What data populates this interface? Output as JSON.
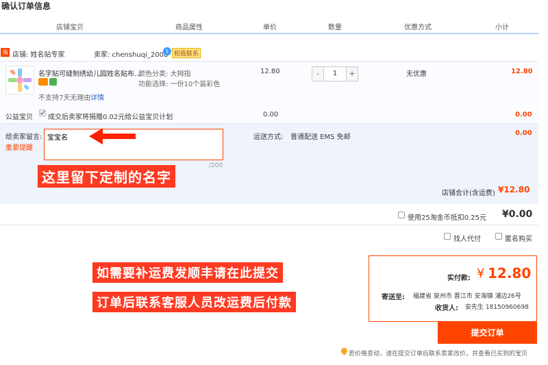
{
  "page_title": "确认订单信息",
  "columns": [
    "店铺宝贝",
    "商品属性",
    "单价",
    "数量",
    "优惠方式",
    "小计"
  ],
  "shop": {
    "icon_text": "淘",
    "label": "店铺: 姓名贴专家",
    "seller": "卖家: chenshuqi_2008",
    "contact": "和我联系"
  },
  "item": {
    "title": "名字贴可缝制绣幼儿园姓名贴布...",
    "attr_color": "颜色分类: 大拇指",
    "attr_func": "功能选择: 一份10个装彩色",
    "no_return": "不支持7天无理由",
    "details_link": "详情",
    "price": "12.80",
    "qty": "1",
    "qty_minus": "-",
    "qty_plus": "+",
    "discount": "无优惠",
    "subtotal": "12.80"
  },
  "charity": {
    "label": "公益宝贝",
    "text": "成交后卖家将捐赠0.02元给公益宝贝计划",
    "price": "0.00",
    "subtotal": "0.00"
  },
  "note": {
    "label": "给卖家留言:",
    "reminder": "重要提醒",
    "value": "宝宝名",
    "counter": "/200",
    "shipping_label": "运送方式:",
    "shipping_value": "普通配送 EMS 免邮",
    "shipping_cost": "0.00",
    "annotation": "这里留下定制的名字"
  },
  "shop_total": {
    "label": "店铺合计(含运费)",
    "value": "¥12.80"
  },
  "coins": {
    "label": "使用25淘金币抵扣0.25元",
    "value": "¥0.00"
  },
  "options": {
    "proxy_pay": "找人代付",
    "anonymous": "匿名购买"
  },
  "annotations": {
    "line1": "如需要补运费发顺丰请在此提交",
    "line2": "订单后联系客服人员改运费后付款"
  },
  "summary": {
    "pay_label": "实付款:",
    "currency": "¥",
    "pay_value": "12.80",
    "ship_to_label": "寄送至:",
    "ship_to_value": "福建省 泉州市 晋江市 安海镇 浦边26号",
    "receiver_label": "收货人:",
    "receiver_value": "安先生 18150960698"
  },
  "submit_label": "提交订单",
  "footer_note": "若价格变动，请在提交订单后联系卖家改价，并查看已买到的宝贝",
  "colors": {
    "accent": "#ff4400",
    "header_line": "#b2d1ff",
    "panel_bg": "#eef3fc"
  }
}
